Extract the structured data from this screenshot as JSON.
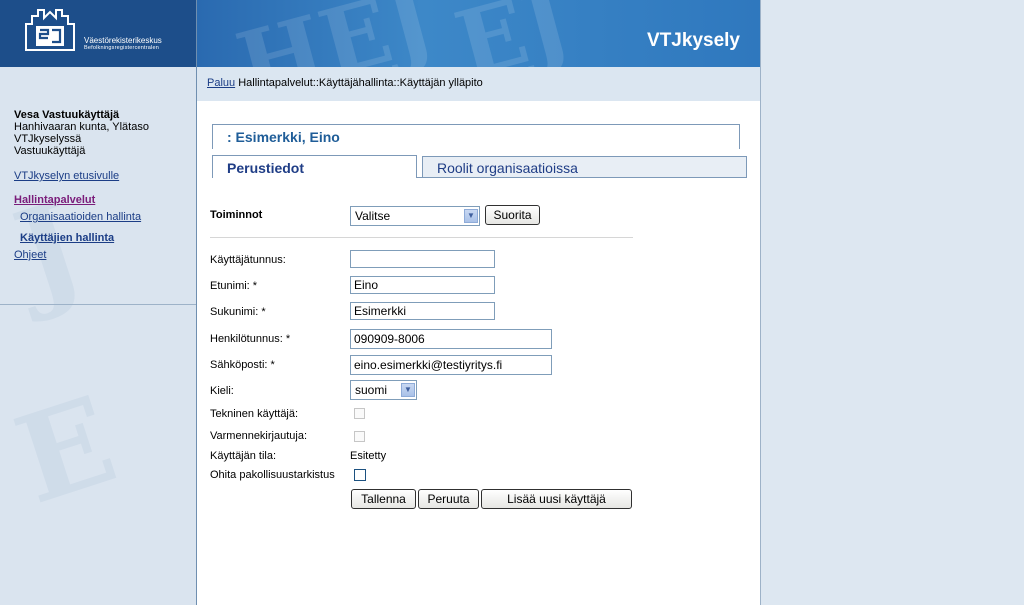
{
  "brand": {
    "org_fi": "Väestörekisterikeskus",
    "org_sv": "Befolkningsregistercentralen",
    "app_title": "VTJkysely"
  },
  "user": {
    "name": "Vesa Vastuukäyttäjä",
    "org": "Hanhivaaran kunta, Ylätaso",
    "line3": "VTJkyselyssä",
    "role": "Vastuukäyttäjä"
  },
  "nav": {
    "home": "VTJkyselyn etusivulle",
    "admin_services": "Hallintapalvelut",
    "org_admin": "Organisaatioiden hallinta",
    "user_admin": "Käyttäjien hallinta",
    "help": "Ohjeet"
  },
  "breadcrumb": {
    "back": "Paluu",
    "path": "Hallintapalvelut::Käyttäjähallinta::Käyttäjän ylläpito"
  },
  "record_title": ": Esimerkki, Eino",
  "tabs": {
    "basic": "Perustiedot",
    "roles": "Roolit organisaatioissa"
  },
  "actions": {
    "label": "Toiminnot",
    "selected": "Valitse",
    "run_button": "Suorita"
  },
  "form": {
    "username_label": "Käyttäjätunnus:",
    "username_value": "",
    "firstname_label": "Etunimi: *",
    "firstname_value": "Eino",
    "lastname_label": "Sukunimi: *",
    "lastname_value": "Esimerkki",
    "ssn_label": "Henkilötunnus: *",
    "ssn_value": "090909-8006",
    "email_label": "Sähköposti: *",
    "email_value": "eino.esimerkki@testiyritys.fi",
    "language_label": "Kieli:",
    "language_value": "suomi",
    "technical_label": "Tekninen käyttäjä:",
    "cert_label": "Varmennekirjautuja:",
    "state_label": "Käyttäjän tila:",
    "state_value": "Esitetty",
    "skip_check_label": "Ohita pakollisuustarkistus"
  },
  "buttons": {
    "save": "Tallenna",
    "cancel": "Peruuta",
    "add_new": "Lisää uusi käyttäjä"
  },
  "colors": {
    "banner": "#2f78be",
    "sidebar": "#dae4ef",
    "link": "#1b3d86",
    "accent": "#1f5d98"
  }
}
